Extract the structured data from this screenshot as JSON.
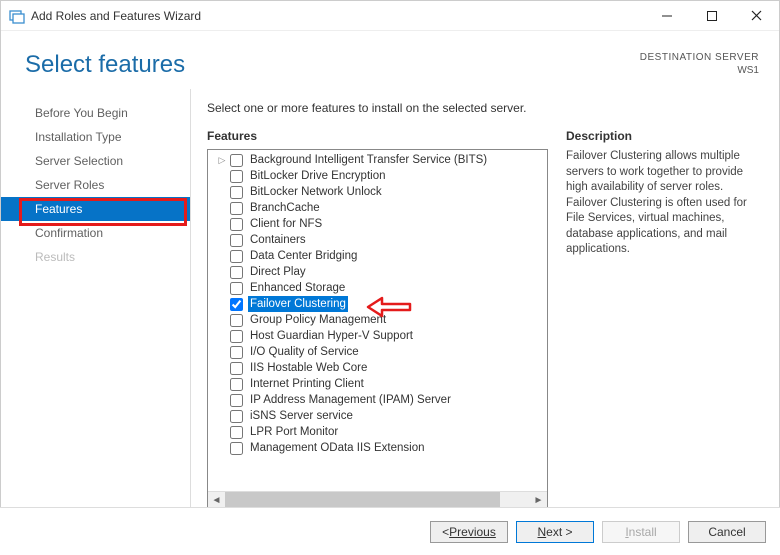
{
  "window": {
    "title": "Add Roles and Features Wizard"
  },
  "header": {
    "title": "Select features",
    "destination_label": "DESTINATION SERVER",
    "destination_value": "WS1"
  },
  "sidebar": {
    "items": [
      {
        "label": "Before You Begin",
        "state": "normal"
      },
      {
        "label": "Installation Type",
        "state": "normal"
      },
      {
        "label": "Server Selection",
        "state": "normal"
      },
      {
        "label": "Server Roles",
        "state": "normal"
      },
      {
        "label": "Features",
        "state": "active"
      },
      {
        "label": "Confirmation",
        "state": "normal"
      },
      {
        "label": "Results",
        "state": "disabled"
      }
    ]
  },
  "content": {
    "instruction": "Select one or more features to install on the selected server.",
    "features_heading": "Features",
    "description_heading": "Description",
    "description_text": "Failover Clustering allows multiple servers to work together to provide high availability of server roles. Failover Clustering is often used for File Services, virtual machines, database applications, and mail applications."
  },
  "features": [
    {
      "label": "Background Intelligent Transfer Service (BITS)",
      "checked": false,
      "expandable": true
    },
    {
      "label": "BitLocker Drive Encryption",
      "checked": false
    },
    {
      "label": "BitLocker Network Unlock",
      "checked": false
    },
    {
      "label": "BranchCache",
      "checked": false
    },
    {
      "label": "Client for NFS",
      "checked": false
    },
    {
      "label": "Containers",
      "checked": false
    },
    {
      "label": "Data Center Bridging",
      "checked": false
    },
    {
      "label": "Direct Play",
      "checked": false
    },
    {
      "label": "Enhanced Storage",
      "checked": false
    },
    {
      "label": "Failover Clustering",
      "checked": true,
      "selected": true
    },
    {
      "label": "Group Policy Management",
      "checked": false
    },
    {
      "label": "Host Guardian Hyper-V Support",
      "checked": false
    },
    {
      "label": "I/O Quality of Service",
      "checked": false
    },
    {
      "label": "IIS Hostable Web Core",
      "checked": false
    },
    {
      "label": "Internet Printing Client",
      "checked": false
    },
    {
      "label": "IP Address Management (IPAM) Server",
      "checked": false
    },
    {
      "label": "iSNS Server service",
      "checked": false
    },
    {
      "label": "LPR Port Monitor",
      "checked": false
    },
    {
      "label": "Management OData IIS Extension",
      "checked": false
    }
  ],
  "footer": {
    "previous": "Previous",
    "next": "Next >",
    "install": "Install",
    "cancel": "Cancel"
  }
}
